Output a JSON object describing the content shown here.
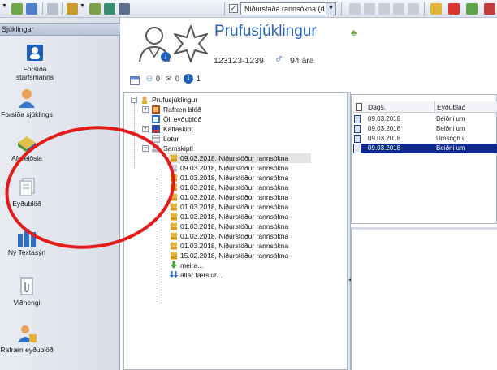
{
  "toolbar": {
    "combo_value": "Niðurstaða rannsókna (d",
    "check_mark": "✓",
    "combo_arrow": "▼"
  },
  "sidebar": {
    "header": "Sjúklingar",
    "items": [
      {
        "label": "Forsíða",
        "label2": "starfsmanns",
        "icon": "user-home-icon"
      },
      {
        "label": "Forsíða sjúklings",
        "icon": "patient-icon"
      },
      {
        "label": "Afgreiðsla",
        "icon": "inbox-icon"
      },
      {
        "label": "Eyðublöð",
        "icon": "forms-icon"
      },
      {
        "label": "Ný Textasýn",
        "icon": "chart-icon"
      },
      {
        "label": "Viðhengi",
        "icon": "attachment-icon"
      },
      {
        "label": "Rafræn eyðublöð",
        "icon": "electronic-forms-icon"
      }
    ]
  },
  "patient": {
    "name": "Prufusjúklingur",
    "flag": "♣",
    "id": "123123-1239",
    "sex_symbol": "♂",
    "age": "94 ára",
    "counts": {
      "a": "0",
      "b": "0",
      "c": "1"
    }
  },
  "tree": {
    "root": "Prufusjúklingur",
    "nodes": [
      {
        "label": "Rafræn blöð",
        "expander": "+"
      },
      {
        "label": "Öll eyðublöð",
        "expander": ""
      },
      {
        "label": "Kaflaskipt",
        "expander": "+"
      },
      {
        "label": "Lotur",
        "expander": ""
      },
      {
        "label": "Samskipti",
        "expander": "−"
      }
    ],
    "entries": [
      "09.03.2018, Niðurstöður rannsókna",
      "09.03.2018, Niðurstöður rannsókna",
      "01.03.2018, Niðurstöður rannsókna",
      "01.03.2018, Niðurstöður rannsókna",
      "01.03.2018, Niðurstöður rannsókna",
      "01.03.2018, Niðurstöður rannsókna",
      "01.03.2018, Niðurstöður rannsókna",
      "01.03.2018, Niðurstöður rannsókna",
      "01.03.2018, Niðurstöður rannsókna",
      "01.03.2018, Niðurstöður rannsókna",
      "15.02.2018, Niðurstöður rannsókna"
    ],
    "more": "meira...",
    "all": "allar færslur..."
  },
  "doc_list": {
    "headers": [
      "Dags.",
      "Eyðublað"
    ],
    "rows": [
      {
        "date": "09.03.2018",
        "type": "Beiðni um"
      },
      {
        "date": "09.03.2018",
        "type": "Beiðni um"
      },
      {
        "date": "09.03.2018",
        "type": "Umsögn u"
      },
      {
        "date": "09.03.2018",
        "type": "Beiðni um"
      }
    ]
  },
  "splitter_arrow": "◀",
  "colors": {
    "accent": "#2b62b8",
    "selection": "#0f2a8a",
    "annotation": "#e21b1b"
  }
}
